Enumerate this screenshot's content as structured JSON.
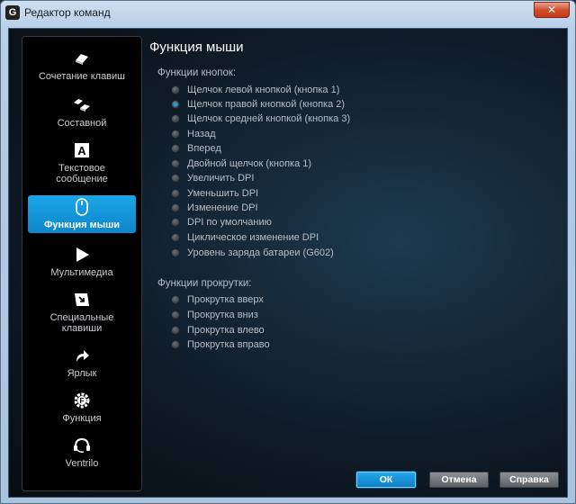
{
  "window": {
    "title": "Редактор команд",
    "close_glyph": "✕"
  },
  "sidebar": {
    "items": [
      {
        "label": "Сочетание клавиш",
        "icon": "keys-icon"
      },
      {
        "label": "Составной",
        "icon": "multi-key-icon"
      },
      {
        "label": "Текстовое сообщение",
        "icon": "text-a-icon"
      },
      {
        "label": "Функция мыши",
        "icon": "mouse-icon",
        "active": true
      },
      {
        "label": "Мультимедиа",
        "icon": "play-icon"
      },
      {
        "label": "Специальные клавиши",
        "icon": "special-key-icon"
      },
      {
        "label": "Ярлык",
        "icon": "shortcut-arrow-icon"
      },
      {
        "label": "Функция",
        "icon": "function-gear-icon"
      },
      {
        "label": "Ventrilo",
        "icon": "headset-icon"
      }
    ]
  },
  "main": {
    "title": "Функция мыши",
    "buttons_section": {
      "title": "Функции кнопок:",
      "options": [
        "Щелчок левой кнопкой (кнопка 1)",
        "Щелчок правой кнопкой (кнопка 2)",
        "Щелчок средней кнопкой (кнопка 3)",
        "Назад",
        "Вперед",
        "Двойной щелчок (кнопка 1)",
        "Увеличить DPI",
        "Уменьшить DPI",
        "Изменение DPI",
        "DPI по умолчанию",
        "Циклическое изменение DPI",
        "Уровень заряда батареи (G602)"
      ],
      "selected_index": 1
    },
    "scroll_section": {
      "title": "Функции прокрутки:",
      "options": [
        "Прокрутка вверх",
        "Прокрутка вниз",
        "Прокрутка влево",
        "Прокрутка вправо"
      ]
    }
  },
  "footer": {
    "ok_label": "ОК",
    "cancel_label": "Отмена",
    "help_label": "Справка"
  },
  "colors": {
    "accent": "#1aa6e8",
    "panel": "#000000"
  }
}
